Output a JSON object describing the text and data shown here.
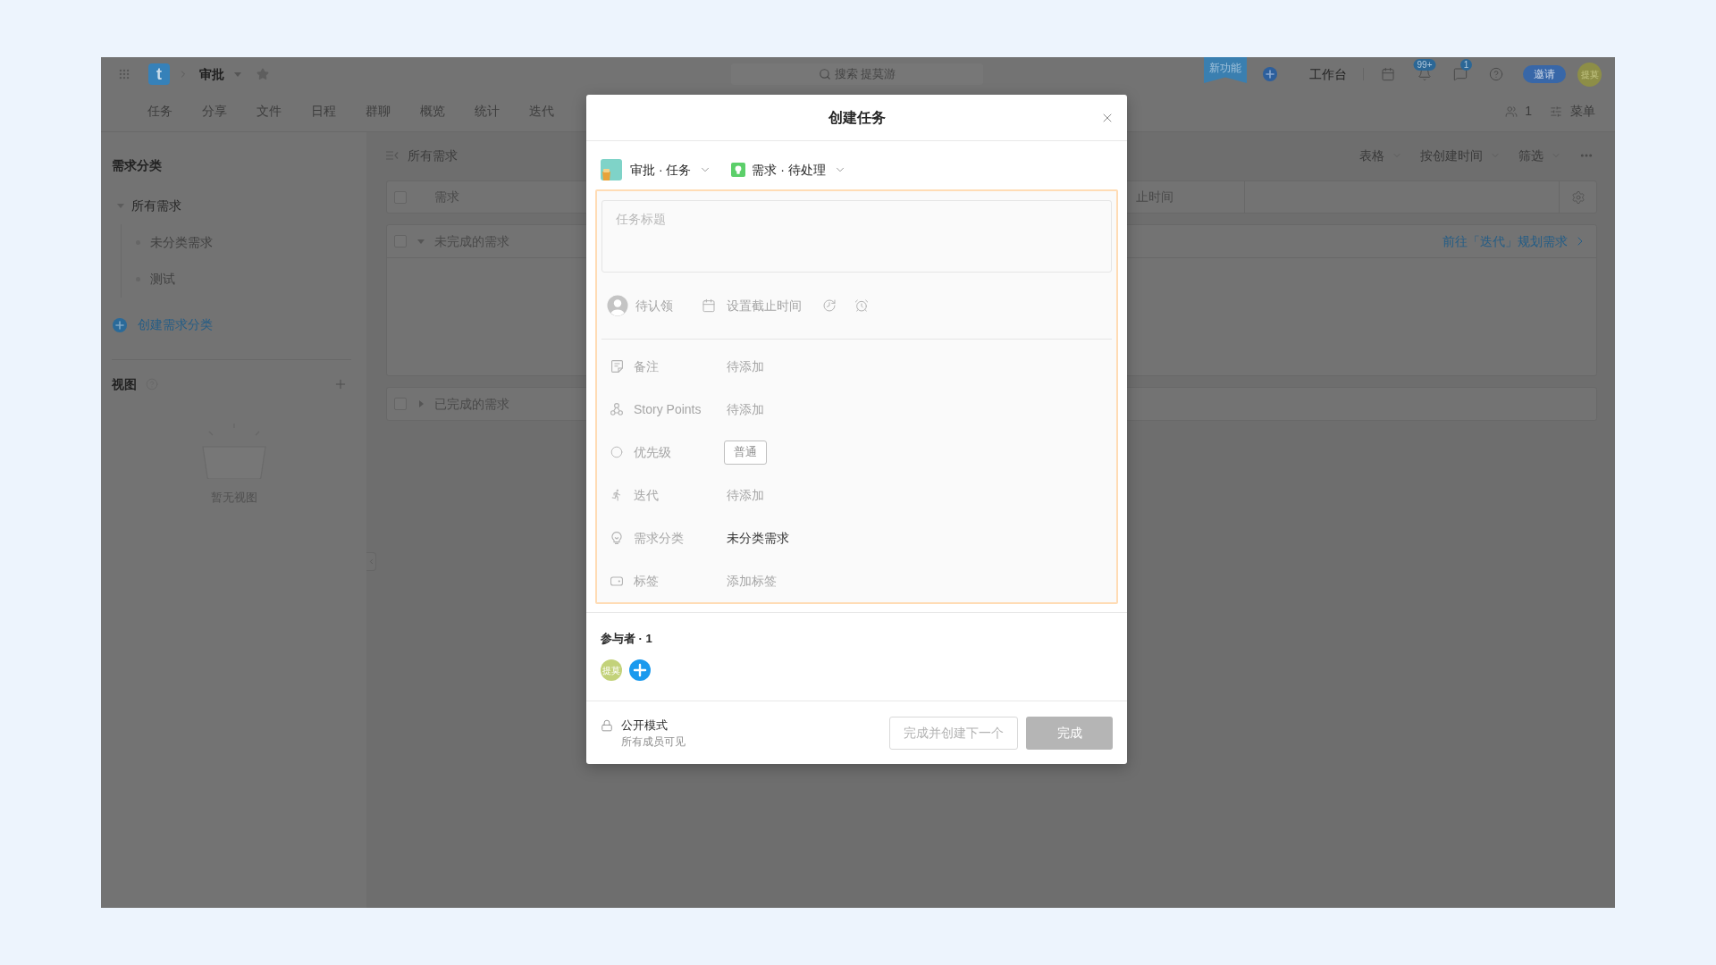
{
  "app_bar": {
    "logo": "t",
    "project": "审批",
    "search": {
      "placeholder": "搜索 提莫游"
    },
    "new_feature": "新功能",
    "workbench": "工作台",
    "notification_count": "99+",
    "message_count": "1",
    "invite": "邀请",
    "avatar": "提莫"
  },
  "nav": {
    "tabs": [
      {
        "label": "任务",
        "selected": false
      },
      {
        "label": "分享",
        "selected": false
      },
      {
        "label": "文件",
        "selected": false
      },
      {
        "label": "日程",
        "selected": false
      },
      {
        "label": "群聊",
        "selected": false
      },
      {
        "label": "概览",
        "selected": false
      },
      {
        "label": "统计",
        "selected": false
      },
      {
        "label": "迭代",
        "selected": false
      }
    ],
    "members": "1",
    "menu": "菜单"
  },
  "sidebar": {
    "title": "需求分类",
    "tree": [
      {
        "label": "所有需求",
        "expanded": true,
        "children": [
          {
            "label": "未分类需求"
          },
          {
            "label": "测试"
          }
        ]
      }
    ],
    "create": "创建需求分类",
    "views_title": "视图",
    "views_empty": "暂无视图"
  },
  "main": {
    "title": "所有需求",
    "toolbar": [
      "表格",
      "按创建时间",
      "筛选"
    ],
    "table": {
      "checked": false,
      "columns": [
        "需求",
        "止时间"
      ],
      "groups": [
        {
          "label": "未完成的需求",
          "checked": false,
          "expanded": true,
          "link": "前往「迭代」规划需求"
        },
        {
          "label": "已完成的需求",
          "checked": false,
          "expanded": false
        }
      ]
    }
  },
  "dialog": {
    "title": "创建任务",
    "project": "审批 · 任务",
    "task_type": "需求 · 待处理",
    "task_title": {
      "placeholder": "任务标题"
    },
    "assignee": "待认领",
    "due_date": "设置截止时间",
    "fields": [
      {
        "kind": "text",
        "label": "备注",
        "placeholder": "待添加"
      },
      {
        "kind": "text",
        "label": "Story Points",
        "placeholder": "待添加"
      },
      {
        "kind": "choice",
        "label": "优先级",
        "value": "普通"
      },
      {
        "kind": "text",
        "label": "迭代",
        "placeholder": "待添加"
      },
      {
        "kind": "text",
        "label": "需求分类",
        "value": "未分类需求"
      },
      {
        "kind": "text",
        "label": "标签",
        "placeholder": "添加标签"
      }
    ],
    "participants": {
      "title": "参与者 · 1",
      "members": [
        "提莫"
      ]
    },
    "visibility": {
      "title": "公开模式",
      "note": "所有成员可见"
    },
    "buttons": [
      {
        "kind": "outline",
        "label": "完成并创建下一个",
        "disabled": true
      },
      {
        "kind": "primary",
        "label": "完成",
        "disabled": true
      }
    ]
  }
}
